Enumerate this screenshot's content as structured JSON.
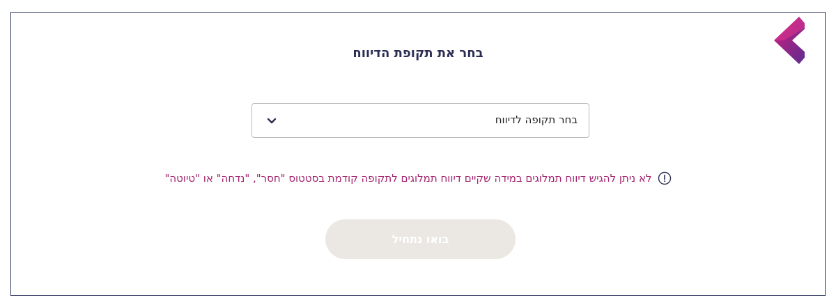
{
  "colors": {
    "frame_border": "#2c3560",
    "title": "#2b2d52",
    "warning": "#a3246e",
    "button_disabled_bg": "#ebe8e3",
    "logo_gradient": [
      "#d01f7c",
      "#5a2d91"
    ]
  },
  "logo": {
    "icon": "chevron-left-brand-icon"
  },
  "page": {
    "title": "בחר את תקופת הדיווח"
  },
  "period_select": {
    "selected_value": "בחר תקופה לדיווח",
    "icon": "chevron-down-icon"
  },
  "warning": {
    "icon": "exclamation-circle-icon",
    "text": "לא ניתן להגיש דיווח תמלוגים במידה שקיים דיווח תמלוגים לתקופה קודמת בסטטוס \"חסר\", \"נדחה\" או \"טיוטה\""
  },
  "start_button": {
    "label": "בואו נתחיל",
    "disabled": true
  }
}
